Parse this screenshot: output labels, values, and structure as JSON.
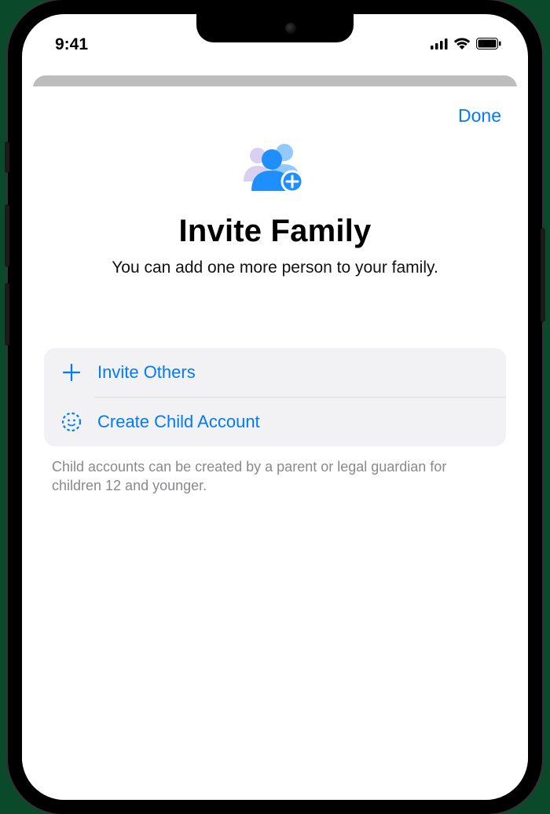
{
  "statusbar": {
    "time": "9:41"
  },
  "sheet": {
    "done_label": "Done",
    "title": "Invite Family",
    "subtitle": "You can add one more person to your family.",
    "options": {
      "invite_others": "Invite Others",
      "create_child": "Create Child Account"
    },
    "footnote": "Child accounts can be created by a parent or legal guardian for children 12 and younger."
  }
}
